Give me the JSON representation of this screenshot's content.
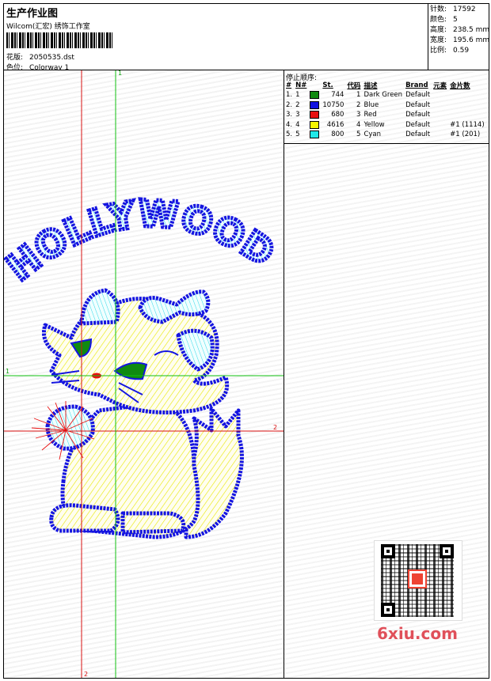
{
  "header": {
    "title": "生产作业图",
    "company": "Wilcom(汇宏) 绣饰工作室",
    "design_label": "花版:",
    "design_value": "2050535.dst",
    "colorway_label": "色位:",
    "colorway_value": "Colorway 1"
  },
  "stats": [
    {
      "label": "针数:",
      "value": "17592"
    },
    {
      "label": "颜色:",
      "value": "5"
    },
    {
      "label": "高度:",
      "value": "238.5 mm"
    },
    {
      "label": "宽度:",
      "value": "195.6 mm"
    },
    {
      "label": "比例:",
      "value": "0.59"
    }
  ],
  "axes": {
    "v1_top": "1",
    "h1_left": "1",
    "h2_right": "2",
    "v2_bottom": "2"
  },
  "design_text": "HOLLYWOOD",
  "stop_sequence": {
    "title": "停止顺序:",
    "headers": [
      "#",
      "N#",
      "St.",
      "代码",
      "描述",
      "Brand",
      "元素",
      "金片数"
    ],
    "rows": [
      {
        "idx": "1.",
        "n": "1",
        "color": "#108a10",
        "st": "744",
        "code": "1",
        "desc": "Dark Green",
        "brand": "Default",
        "elem": "",
        "seq": ""
      },
      {
        "idx": "2.",
        "n": "2",
        "color": "#1010e0",
        "st": "10750",
        "code": "2",
        "desc": "Blue",
        "brand": "Default",
        "elem": "",
        "seq": ""
      },
      {
        "idx": "3.",
        "n": "3",
        "color": "#e81010",
        "st": "680",
        "code": "3",
        "desc": "Red",
        "brand": "Default",
        "elem": "",
        "seq": ""
      },
      {
        "idx": "4.",
        "n": "4",
        "color": "#f6f600",
        "st": "4616",
        "code": "4",
        "desc": "Yellow",
        "brand": "Default",
        "elem": "",
        "seq": "#1 (1114)"
      },
      {
        "idx": "5.",
        "n": "5",
        "color": "#20e8e8",
        "st": "800",
        "code": "5",
        "desc": "Cyan",
        "brand": "Default",
        "elem": "",
        "seq": "#1 (201)"
      }
    ]
  },
  "watermark": "6xiu.com"
}
